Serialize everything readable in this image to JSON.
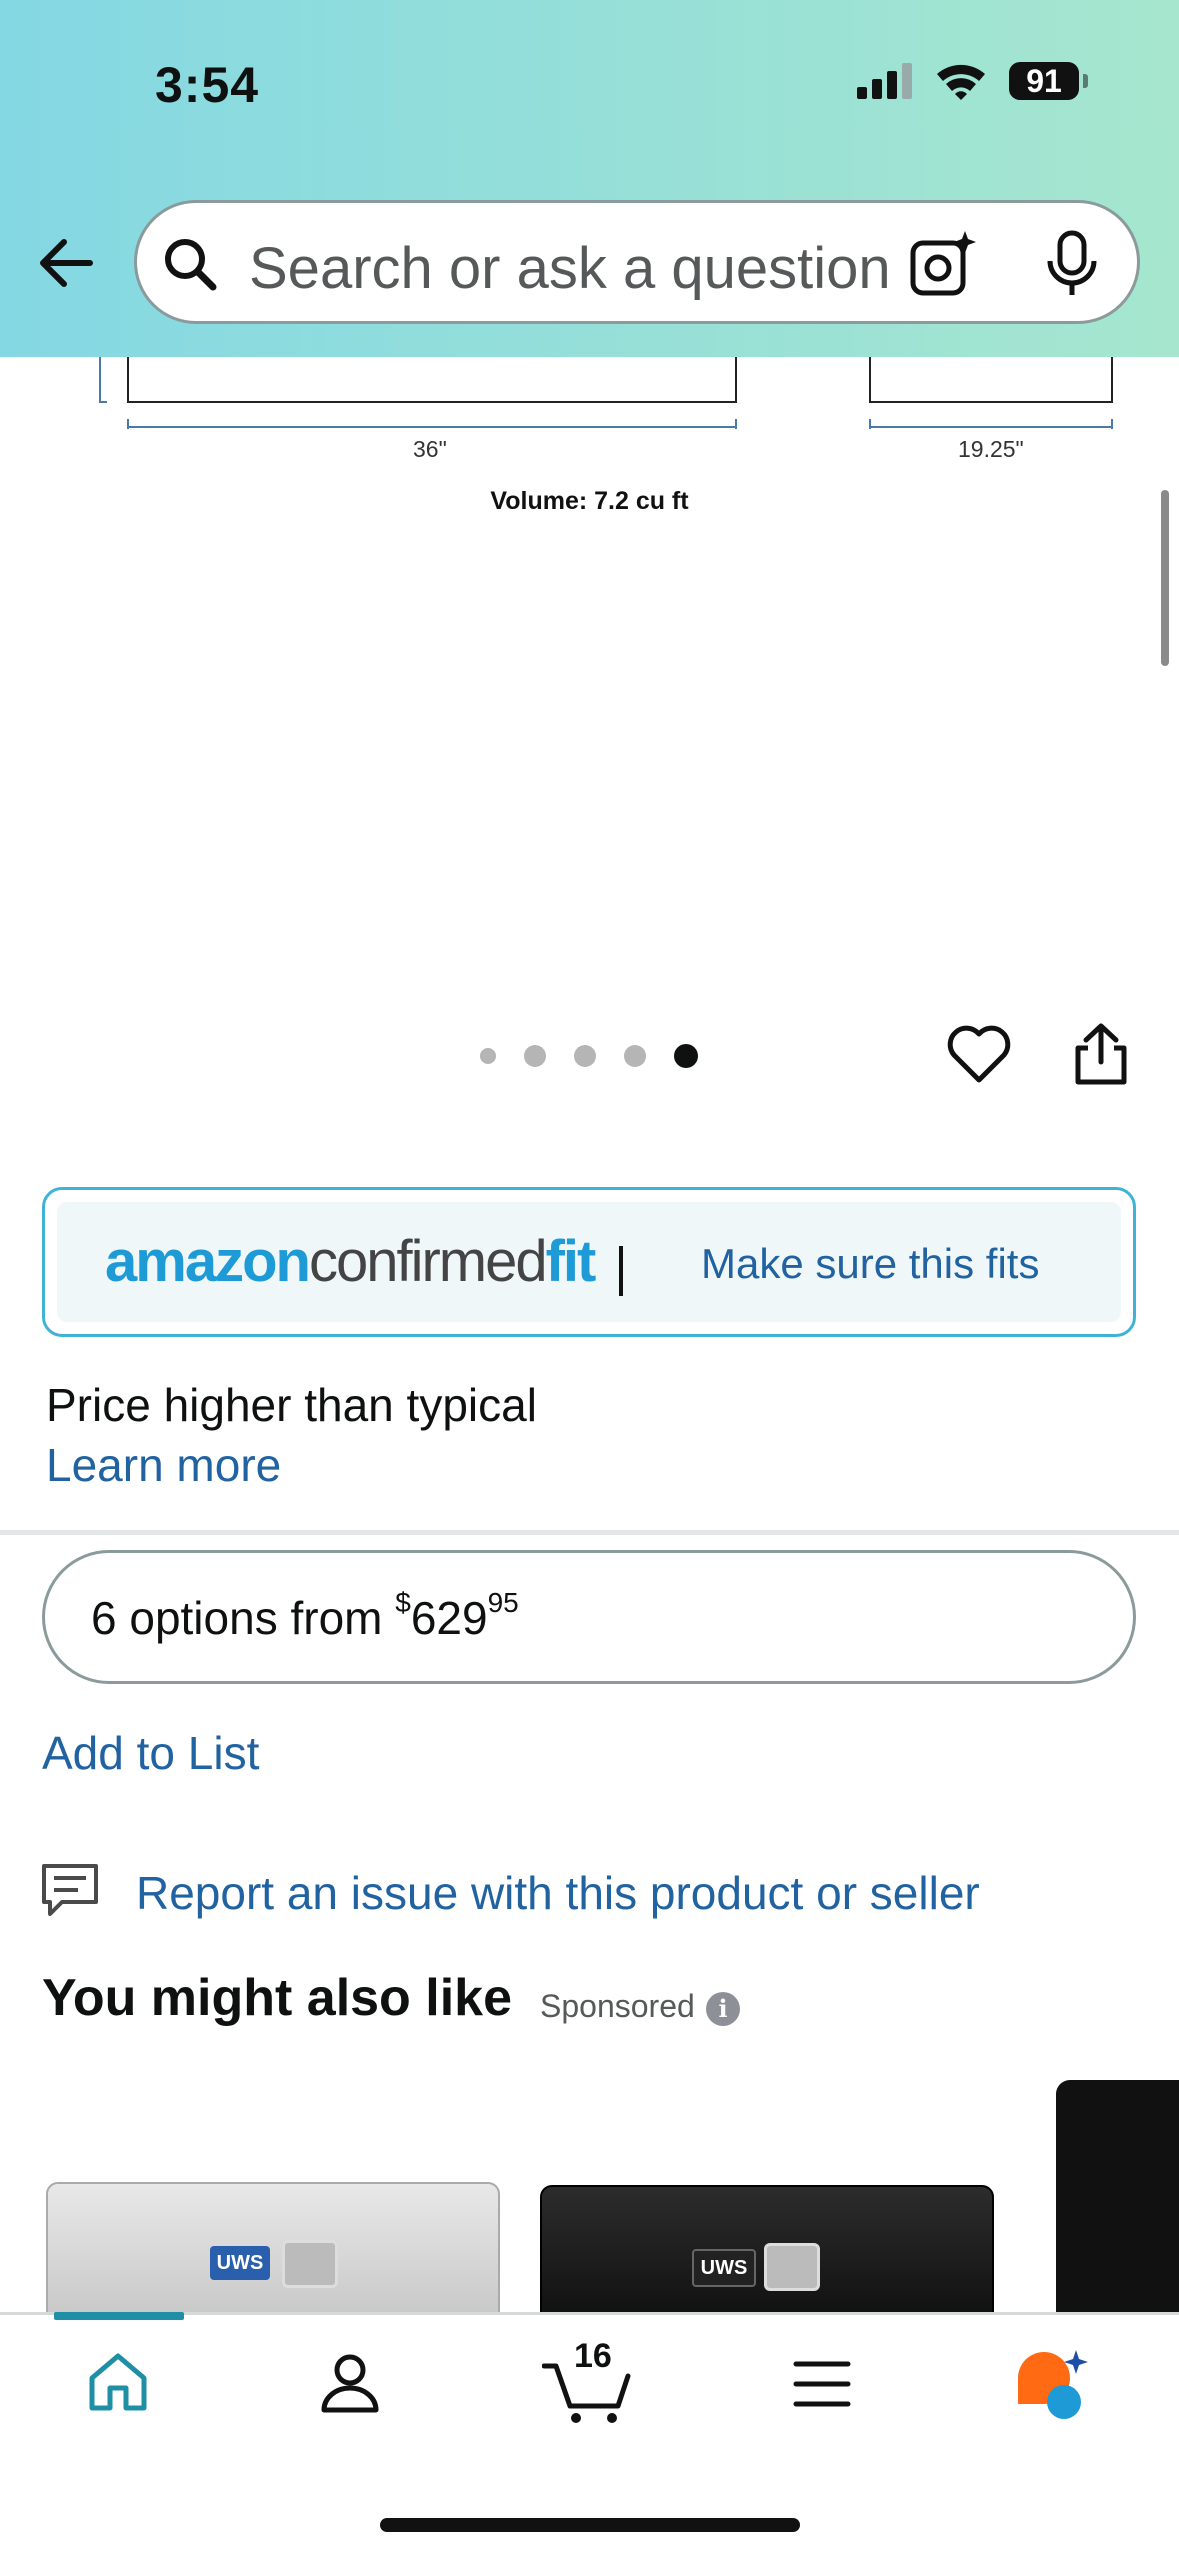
{
  "status_bar": {
    "time": "3:54",
    "battery": "91"
  },
  "search": {
    "placeholder": "Search or ask a question"
  },
  "diagram": {
    "width_label": "36\"",
    "depth_label": "19.25\"",
    "volume_label": "Volume: 7.2 cu ft"
  },
  "image_carousel": {
    "dot_count": 5,
    "active_index": 4
  },
  "confirmed_fit": {
    "logo_part1": "amazon",
    "logo_part2": "confirmed",
    "logo_part3": "fit",
    "link": "Make sure this fits"
  },
  "price_note": {
    "text": "Price higher than typical",
    "learn_more": "Learn more"
  },
  "options": {
    "prefix": "6 options from ",
    "currency": "$",
    "dollars": "629",
    "cents": "95"
  },
  "add_to_list": "Add to List",
  "report": "Report an issue with this product or seller",
  "recommendations": {
    "title": "You might also like",
    "sponsored": "Sponsored",
    "info": "i"
  },
  "products": [
    {
      "badge": "UWS",
      "color": "silver"
    },
    {
      "badge": "UWS",
      "color": "black"
    },
    {
      "badge": "",
      "color": "black"
    }
  ],
  "bottom_nav": {
    "items": [
      "home-icon",
      "account-icon",
      "cart-icon",
      "menu-icon",
      "rufus-icon"
    ],
    "cart_count": "16"
  },
  "colors": {
    "link": "#2162a1",
    "accent_teal": "#1e8fa5",
    "fit_border": "#3fb3d6"
  }
}
